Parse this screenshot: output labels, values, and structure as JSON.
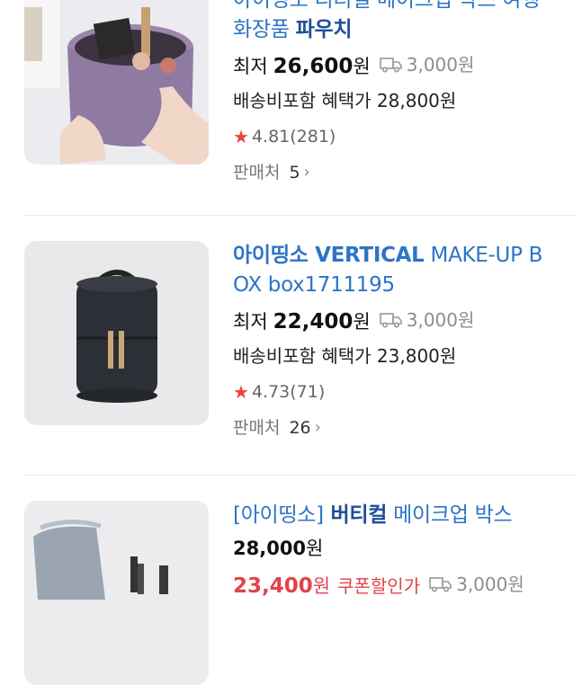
{
  "products": [
    {
      "title_line1": "아이띵소 리티컬 메이크업 박스 여행",
      "title_line2_normal": "화장품 ",
      "title_line2_bold": "파우치",
      "price_label": "최저",
      "price_value": "26,600",
      "price_unit": "원",
      "shipping": "3,000원",
      "benefit": "배송비포함 혜택가 28,800원",
      "rating": "4.81",
      "review_count": "(281)",
      "sellers_label": "판매처",
      "sellers_count": "5"
    },
    {
      "title_bold": "아이띵소 VERTICAL",
      "title_rest_line1": " MAKE-UP B",
      "title_line2": "OX box1711195",
      "price_label": "최저",
      "price_value": "22,400",
      "price_unit": "원",
      "shipping": "3,000원",
      "benefit": "배송비포함 혜택가 23,800원",
      "rating": "4.73",
      "review_count": "(71)",
      "sellers_label": "판매처",
      "sellers_count": "26"
    },
    {
      "title_bracket_open": "[",
      "title_brand": "아이띵소",
      "title_bracket_close": "]",
      "title_bold": " 버티컬",
      "title_rest": " 메이크업 박스",
      "price_value": "28,000",
      "price_unit": "원",
      "coupon_price": "23,400",
      "coupon_unit": "원",
      "coupon_label": "쿠폰할인가",
      "shipping": "3,000원"
    }
  ],
  "colors": {
    "title_blue": "#2d74c7",
    "star_red": "#e8453c",
    "coupon_red": "#e0434a"
  },
  "icons": [
    "truck-icon",
    "star-icon",
    "chevron-right-icon"
  ]
}
